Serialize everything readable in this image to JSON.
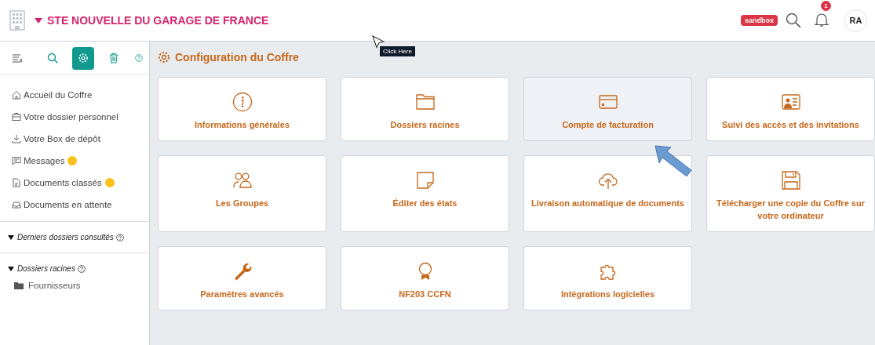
{
  "header": {
    "company": "STE NOUVELLE DU GARAGE DE FRANCE",
    "env_badge": "sandbox",
    "notification_count": "1",
    "avatar": "RA"
  },
  "tooltip": {
    "text": "Click Here"
  },
  "toolbar": [
    {
      "kind": "collapse",
      "selected": false
    },
    {
      "kind": "search",
      "selected": false
    },
    {
      "kind": "settings",
      "selected": true
    },
    {
      "kind": "trash",
      "selected": false
    },
    {
      "kind": "help",
      "selected": false
    }
  ],
  "sidebar": {
    "items": [
      {
        "kind": "home",
        "label": "Accueil du Coffre",
        "dot": false
      },
      {
        "kind": "briefcase",
        "label": "Votre dossier personnel",
        "dot": false
      },
      {
        "kind": "download",
        "label": "Votre Box de dépôt",
        "dot": false
      },
      {
        "kind": "message",
        "label": "Messages",
        "dot": true
      },
      {
        "kind": "document",
        "label": "Documents classés",
        "dot": true
      },
      {
        "kind": "inbox",
        "label": "Documents en attente",
        "dot": false
      }
    ],
    "sections": [
      {
        "label": "Derniers dossiers consultés",
        "expanded": true
      },
      {
        "label": "Dossiers racines",
        "expanded": true,
        "children": [
          {
            "label": "Fournisseurs"
          }
        ]
      }
    ]
  },
  "page_title": "Configuration du Coffre",
  "cards": [
    {
      "kind": "info",
      "label": "Informations générales",
      "highlighted": false
    },
    {
      "kind": "folder",
      "label": "Dossiers racines",
      "highlighted": false
    },
    {
      "kind": "card",
      "label": "Compte de facturation",
      "highlighted": true
    },
    {
      "kind": "idcard",
      "label": "Suivi des accès et des invitations",
      "highlighted": false
    },
    {
      "kind": "people",
      "label": "Les Groupes",
      "highlighted": false
    },
    {
      "kind": "note",
      "label": "Éditer des états",
      "highlighted": false
    },
    {
      "kind": "upload",
      "label": "Livraison automatique de documents",
      "highlighted": false
    },
    {
      "kind": "save",
      "label": "Télécharger une copie du Coffre sur votre ordinateur",
      "highlighted": false
    },
    {
      "kind": "wrench",
      "label": "Paramètres avancés",
      "highlighted": false
    },
    {
      "kind": "award",
      "label": "NF203 CCFN",
      "highlighted": false
    },
    {
      "kind": "puzzle",
      "label": "Intégrations logicielles",
      "highlighted": false
    }
  ]
}
